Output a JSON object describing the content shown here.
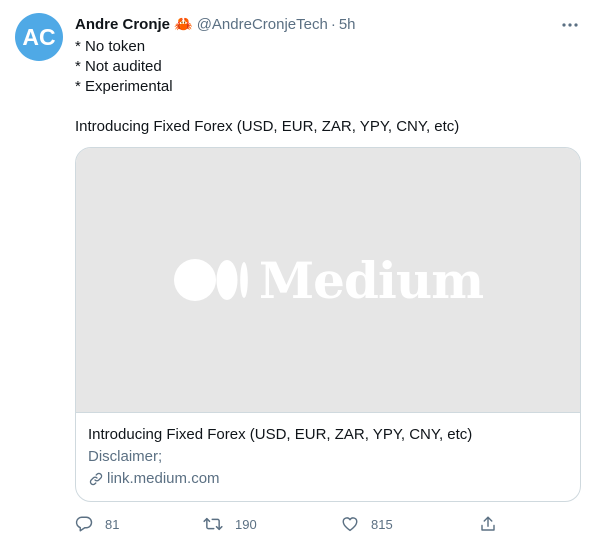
{
  "author": {
    "avatar_initials": "AC",
    "avatar_color": "#4fa9e6",
    "name": "Andre Cronje",
    "name_emoji": "🦀",
    "handle": "@AndreCronjeTech",
    "separator": "·",
    "time": "5h"
  },
  "tweet": {
    "lines": [
      "* No token",
      "* Not audited",
      "* Experimental"
    ],
    "intro": "Introducing Fixed Forex (USD, EUR, ZAR, YPY, CNY, etc)"
  },
  "card": {
    "media_brand": "Medium",
    "media_bg": "#e6e6e6",
    "title": "Introducing Fixed Forex (USD, EUR, ZAR, YPY, CNY, etc)",
    "description": "Disclaimer;",
    "domain": "link.medium.com"
  },
  "actions": {
    "reply": {
      "icon": "reply-icon",
      "count": "81"
    },
    "retweet": {
      "icon": "retweet-icon",
      "count": "190"
    },
    "like": {
      "icon": "like-icon",
      "count": "815"
    },
    "share": {
      "icon": "share-icon"
    }
  },
  "colors": {
    "secondary_text": "#5b7083",
    "border": "#cfd9de"
  }
}
